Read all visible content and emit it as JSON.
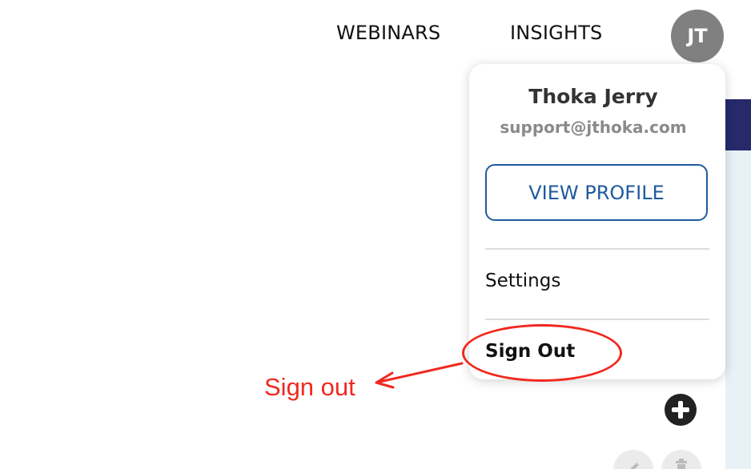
{
  "nav": {
    "links": [
      {
        "label": "WEBINARS"
      },
      {
        "label": "INSIGHTS"
      }
    ],
    "avatar_initials": "JT"
  },
  "user_menu": {
    "name": "Thoka Jerry",
    "email": "support@jthoka.com",
    "view_profile_label": "VIEW PROFILE",
    "items": [
      {
        "label": "Settings"
      },
      {
        "label": "Sign Out"
      }
    ]
  },
  "annotation": {
    "text": "Sign out",
    "color": "#f1281e"
  },
  "colors": {
    "accent": "#1f5a9e",
    "avatar_bg": "#808080",
    "side_header": "#262a6b"
  },
  "icons": {
    "add": "plus-circle-icon",
    "edit": "pencil-icon",
    "delete": "trash-icon"
  }
}
